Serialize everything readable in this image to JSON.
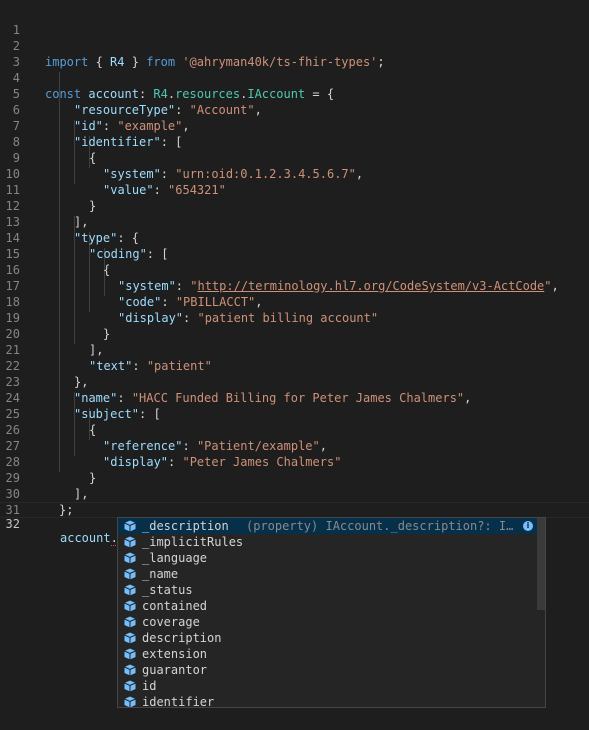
{
  "editor": {
    "line_numbers": [
      "1",
      "2",
      "3",
      "4",
      "5",
      "6",
      "7",
      "8",
      "9",
      "10",
      "11",
      "12",
      "13",
      "14",
      "15",
      "16",
      "17",
      "18",
      "19",
      "20",
      "21",
      "22",
      "23",
      "24",
      "25",
      "26",
      "27",
      "28",
      "29",
      "30",
      "31",
      "32"
    ],
    "lines": {
      "l2": {
        "t1": "import",
        "t2": " { ",
        "t3": "R4",
        "t4": " } ",
        "t5": "from",
        "t6": " ",
        "t7": "'@ahryman40k/ts-fhir-types'",
        "t8": ";"
      },
      "l4": {
        "t1": "const",
        "t2": " ",
        "t3": "account",
        "t4": ": ",
        "t5": "R4",
        "t6": ".",
        "t7": "resources",
        "t8": ".",
        "t9": "IAccount",
        "t10": " = {"
      },
      "l5": {
        "k": "\"resourceType\"",
        "v": "\"Account\""
      },
      "l6": {
        "k": "\"id\"",
        "v": "\"example\""
      },
      "l7": {
        "k": "\"identifier\"",
        "rest": ": ["
      },
      "l8": {
        "txt": "{"
      },
      "l9": {
        "k": "\"system\"",
        "v": "\"urn:oid:0.1.2.3.4.5.6.7\""
      },
      "l10": {
        "k": "\"value\"",
        "v": "\"654321\""
      },
      "l11": {
        "txt": "}"
      },
      "l12": {
        "txt": "],"
      },
      "l13": {
        "k": "\"type\"",
        "rest": ": {"
      },
      "l14": {
        "k": "\"coding\"",
        "rest": ": ["
      },
      "l15": {
        "txt": "{"
      },
      "l16": {
        "k": "\"system\"",
        "q1": "\"",
        "url": "http://terminology.hl7.org/CodeSystem/v3-ActCode",
        "q2": "\""
      },
      "l17": {
        "k": "\"code\"",
        "v": "\"PBILLACCT\""
      },
      "l18": {
        "k": "\"display\"",
        "v": "\"patient billing account\""
      },
      "l19": {
        "txt": "}"
      },
      "l20": {
        "txt": "],"
      },
      "l21": {
        "k": "\"text\"",
        "v": "\"patient\""
      },
      "l22": {
        "txt": "},"
      },
      "l23": {
        "k": "\"name\"",
        "v": "\"HACC Funded Billing for Peter James Chalmers\""
      },
      "l24": {
        "k": "\"subject\"",
        "rest": ": ["
      },
      "l25": {
        "txt": "{"
      },
      "l26": {
        "k": "\"reference\"",
        "v": "\"Patient/example\""
      },
      "l27": {
        "k": "\"display\"",
        "v": "\"Peter James Chalmers\""
      },
      "l28": {
        "txt": "}"
      },
      "l29": {
        "txt": "],"
      },
      "l30": {
        "txt": "};"
      },
      "l32": {
        "obj": "account",
        "dot": "."
      }
    }
  },
  "suggest": {
    "selected_detail": "(property) IAccount._description?: IE…",
    "info_glyph": "i",
    "items": [
      "_description",
      "_implicitRules",
      "_language",
      "_name",
      "_status",
      "contained",
      "coverage",
      "description",
      "extension",
      "guarantor",
      "id",
      "identifier"
    ]
  },
  "colors": {
    "background": "#1e1e1e",
    "keyword": "#569cd6",
    "property": "#9cdcfe",
    "string": "#ce9178",
    "type": "#4ec9b0",
    "icon_blue": "#75beff"
  }
}
